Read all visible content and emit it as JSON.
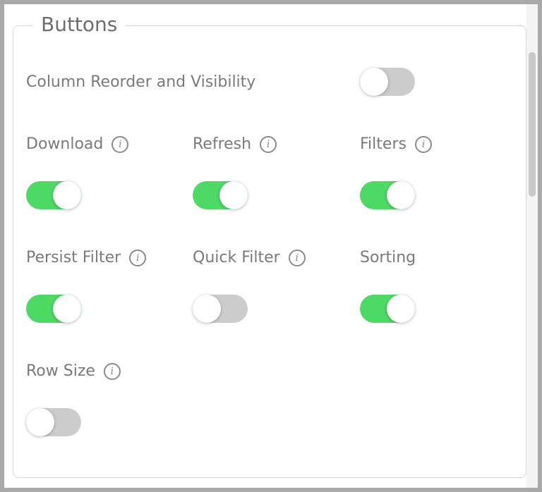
{
  "panel": {
    "legend": "Buttons",
    "options": [
      {
        "key": "column_reorder",
        "label": "Column Reorder and Visibility",
        "info": false,
        "enabled": false
      },
      {
        "key": "download",
        "label": "Download",
        "info": true,
        "enabled": true
      },
      {
        "key": "refresh",
        "label": "Refresh",
        "info": true,
        "enabled": true
      },
      {
        "key": "filters",
        "label": "Filters",
        "info": true,
        "enabled": true
      },
      {
        "key": "persist_filter",
        "label": "Persist Filter",
        "info": true,
        "enabled": true
      },
      {
        "key": "quick_filter",
        "label": "Quick Filter",
        "info": true,
        "enabled": false
      },
      {
        "key": "sorting",
        "label": "Sorting",
        "info": false,
        "enabled": true
      },
      {
        "key": "row_size",
        "label": "Row Size",
        "info": true,
        "enabled": false
      }
    ]
  },
  "info_glyph": "i",
  "colors": {
    "toggle_on": "#4cd964",
    "toggle_off": "#cccccc",
    "label_text": "#7a7a7a",
    "legend_text": "#6d6d6d"
  }
}
